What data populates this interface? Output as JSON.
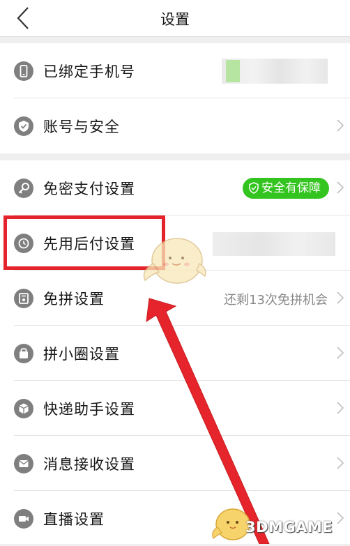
{
  "header": {
    "title": "设置"
  },
  "group1": [
    {
      "label": "已绑定手机号",
      "icon": "phone-icon"
    },
    {
      "label": "账号与安全",
      "icon": "shield-icon"
    }
  ],
  "group2": [
    {
      "label": "免密支付设置",
      "icon": "key-icon",
      "badge": "安全有保障"
    },
    {
      "label": "先用后付设置",
      "icon": "clock-icon"
    },
    {
      "label": "免拼设置",
      "icon": "coupon-icon",
      "hint": "还剩13次免拼机会"
    },
    {
      "label": "拼小圈设置",
      "icon": "bag-icon"
    },
    {
      "label": "快递助手设置",
      "icon": "package-icon"
    },
    {
      "label": "消息接收设置",
      "icon": "envelope-icon"
    },
    {
      "label": "直播设置",
      "icon": "video-camera-icon"
    }
  ],
  "watermark": "3DMGAME",
  "colors": {
    "badge": "#34c41f",
    "highlight": "#e4242c",
    "icon": "#7f7f7f"
  }
}
